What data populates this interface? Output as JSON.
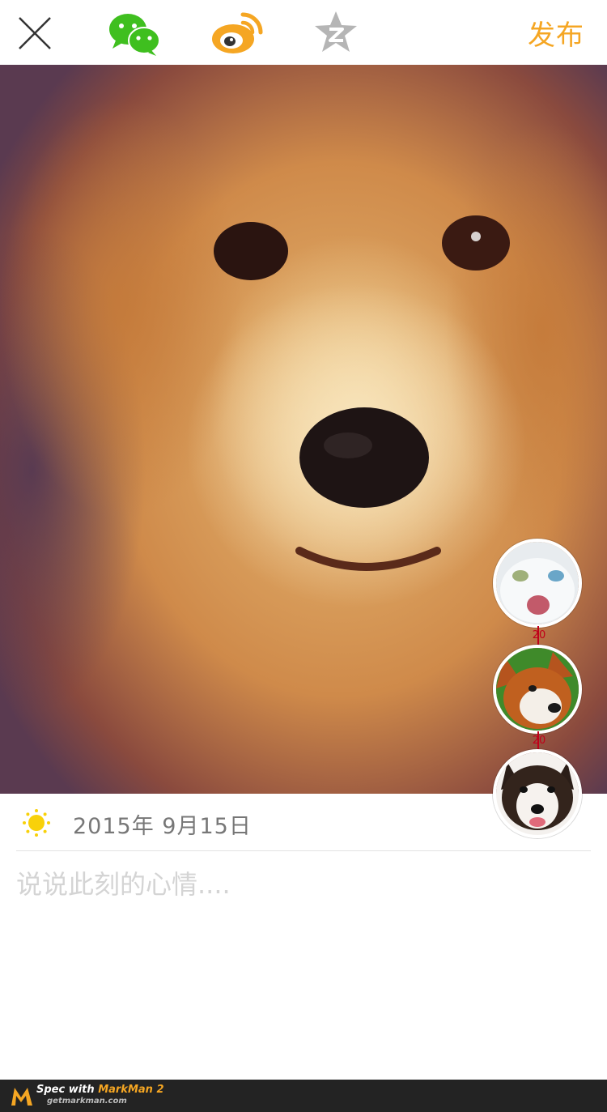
{
  "topbar": {
    "close_icon": "close-icon",
    "wechat_icon": "wechat-icon",
    "weibo_icon": "weibo-icon",
    "qzone_icon": "qzone-star-icon",
    "publish_label": "发布",
    "accent_color": "#f5a623"
  },
  "photo": {
    "subject": "dog-photo"
  },
  "avatars": [
    {
      "name": "white-cat-avatar"
    },
    {
      "name": "red-husky-avatar"
    },
    {
      "name": "black-husky-avatar"
    }
  ],
  "spacing_labels": [
    "20",
    "20"
  ],
  "date_row": {
    "icon": "sun-icon",
    "date_text": "2015年 9月15日"
  },
  "mood": {
    "placeholder": "说说此刻的心情....",
    "value": ""
  },
  "footer": {
    "title_prefix": "Spec with ",
    "title_brand": "MarkMan 2",
    "subtitle": "getmarkman.com"
  }
}
